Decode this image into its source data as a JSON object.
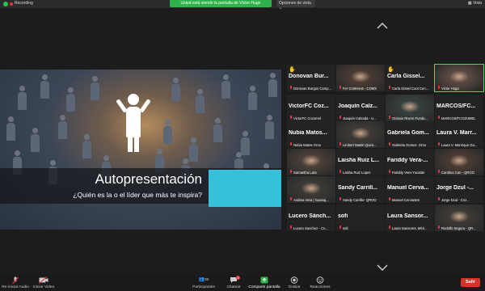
{
  "topbar": {
    "recording_label": "Recording",
    "share_banner": "Usted está viendo la pantalla de Víctor Hugo",
    "view_options_label": "Opciones de vista",
    "view_button_label": "Vista"
  },
  "presentation": {
    "title": "Autopresentación",
    "subtitle": "¿Quién es la o el líder que más te inspira?"
  },
  "gallery": {
    "tiles": [
      {
        "name": "Donovan Bur...",
        "label": "Donovan Burgos Camp...",
        "hand": true,
        "video": false
      },
      {
        "name": "",
        "label": "Fer Contreras - CDMX",
        "hand": false,
        "video": true
      },
      {
        "name": "Carla Gissel...",
        "label": "Carla Gissel Coot Cen...",
        "hand": true,
        "video": false
      },
      {
        "name": "",
        "label": "Victor Hugo",
        "hand": false,
        "video": true,
        "active": true
      },
      {
        "name": "VictorFC Coz...",
        "label": "VictorFC Cozumel",
        "hand": false,
        "video": false
      },
      {
        "name": "Joaquín Calz...",
        "label": "Joaquín Calzada - U...",
        "hand": false,
        "video": false
      },
      {
        "name": "",
        "label": "Octavio Rivero Funda...",
        "hand": false,
        "video": true
      },
      {
        "name": "MARCOS/FC...",
        "label": "MARCOS/FCOZUMEL",
        "hand": false,
        "video": false
      },
      {
        "name": "Nubia Matos...",
        "label": "Nubia Matos Groo",
        "hand": false,
        "video": false
      },
      {
        "name": "",
        "label": "Limbert Martin Quint...",
        "hand": false,
        "video": true
      },
      {
        "name": "Gabriela Gom...",
        "label": "Gabriela Gomez. Groo",
        "hand": false,
        "video": false
      },
      {
        "name": "Laura V. Marr...",
        "label": "Laura V. Manrique Ga...",
        "hand": false,
        "video": false
      },
      {
        "name": "",
        "label": "Samantha Lara",
        "hand": false,
        "video": true
      },
      {
        "name": "Laisha Ruiz L...",
        "label": "Laisha Ruiz Lopez",
        "hand": false,
        "video": false
      },
      {
        "name": "Fariddy Vera-...",
        "label": "Fariddy Vera-Yucatán",
        "hand": false,
        "video": false
      },
      {
        "name": "",
        "label": "Carolina Can - QROO",
        "hand": false,
        "video": true
      },
      {
        "name": "",
        "label": "Andrea Vera | Guanaj...",
        "hand": false,
        "video": true
      },
      {
        "name": "Sandy Carrill...",
        "label": "Sandy Carrillo- QROO",
        "hand": false,
        "video": false
      },
      {
        "name": "Manuel Cerva...",
        "label": "Manuel Cervantes",
        "hand": false,
        "video": false
      },
      {
        "name": "Jorge Dzul -...",
        "label": "Jorge Dzul - Coz...",
        "hand": false,
        "video": false
      },
      {
        "name": "Lucero Sánch...",
        "label": "Lucero Sanchez - Co...",
        "hand": false,
        "video": false
      },
      {
        "name": "sofi",
        "label": "sofi",
        "hand": false,
        "video": false
      },
      {
        "name": "Laura Sansor...",
        "label": "Laura Sansores, Méri...",
        "hand": false,
        "video": false
      },
      {
        "name": "",
        "label": "Rodolfo Segura - QR...",
        "hand": false,
        "video": true
      }
    ]
  },
  "toolbar": {
    "unmute": "Re-iniciar Audio",
    "start_video": "Iniciar Video",
    "participants": "Participantes",
    "participants_count": "80",
    "chat": "Chatear",
    "chat_badge": "3",
    "share": "Compartir pantalla",
    "record": "Grabar",
    "reactions": "Reacciones",
    "leave": "Salir"
  },
  "colors": {
    "share_banner": "#2fb24a",
    "leave": "#d9302a",
    "active_speaker": "#5ad05a",
    "slide_accent": "#37c0dc"
  }
}
